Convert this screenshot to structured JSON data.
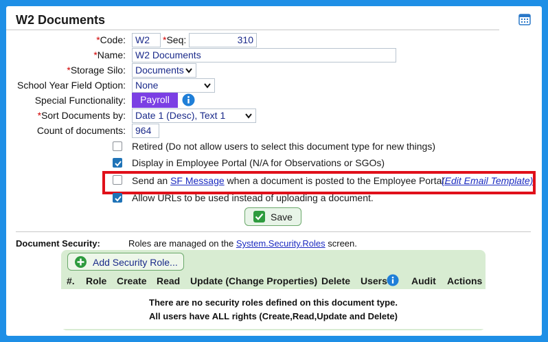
{
  "header": {
    "title": "W2 Documents"
  },
  "form": {
    "code_label": "Code:",
    "code_value": "W2",
    "seq_label": "Seq:",
    "seq_value": "310",
    "name_label": "Name:",
    "name_value": "W2 Documents",
    "storage_label": "Storage Silo:",
    "storage_value": "Documents",
    "school_year_label": "School Year Field Option:",
    "school_year_value": "None",
    "special_label": "Special Functionality:",
    "special_value": "Payroll",
    "sort_label": "Sort Documents by:",
    "sort_value": "Date 1 (Desc), Text 1",
    "count_label": "Count of documents:",
    "count_value": "964",
    "required_mark": "*"
  },
  "options": {
    "retired": {
      "label": "Retired (Do not allow users to select this document type for new things)",
      "checked": false
    },
    "portal": {
      "label": "Display in Employee Portal (N/A for Observations or SGOs)",
      "checked": true
    },
    "sf_message": {
      "prefix": "Send an ",
      "link": "SF Message",
      "suffix": " when a document is posted to the Employee Portal.",
      "template_link": "(Edit Email Template)",
      "checked": false
    },
    "urls": {
      "label": "Allow URLs to be used instead of uploading a document.",
      "checked": true
    }
  },
  "save_button": {
    "label": "Save"
  },
  "security": {
    "label": "Document Security:",
    "note_prefix": "Roles are managed on the ",
    "note_link": "System.Security.Roles",
    "note_suffix": " screen.",
    "add_role_label": "Add Security Role...",
    "columns": [
      "#.",
      "Role",
      "Create",
      "Read",
      "Update (Change Properties)",
      "Delete",
      "Users",
      "Audit",
      "Actions"
    ],
    "empty_line1": "There are no security roles defined on this document type.",
    "empty_line2_prefix": "All users have ",
    "empty_line2_bold": "ALL",
    "empty_line2_suffix": " rights (Create,Read,Update and Delete)"
  },
  "colors": {
    "frame": "#1e8fe6",
    "accent_purple": "#7b3fe4",
    "highlight_red": "#e0101a",
    "checkbox_blue": "#1f73b7",
    "section_green": "#d8ecd2"
  }
}
